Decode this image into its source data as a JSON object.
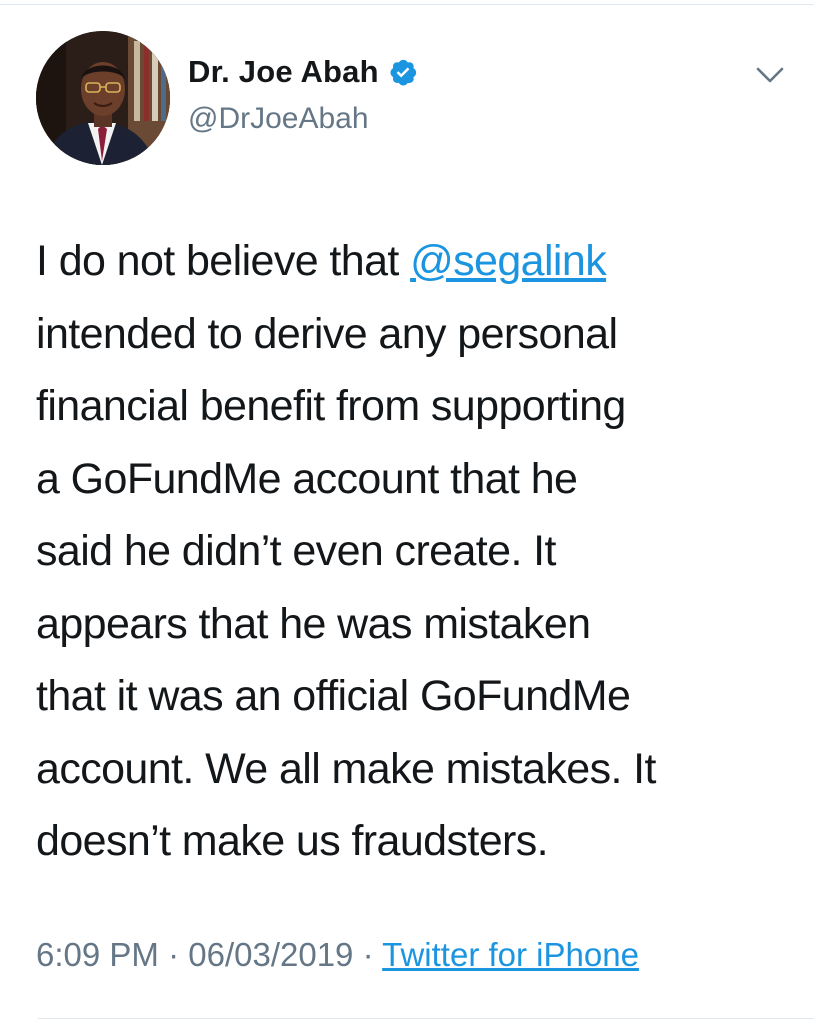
{
  "author": {
    "display_name": "Dr. Joe Abah",
    "handle": "@DrJoeAbah",
    "verified_icon": "verified-badge-icon",
    "avatar_icon": "profile-photo"
  },
  "menu": {
    "icon": "chevron-down-icon"
  },
  "tweet": {
    "lines": [
      {
        "before": "I do not believe that ",
        "mention": "@segalink",
        "after": ""
      },
      {
        "text": "intended to derive any personal"
      },
      {
        "text": "financial benefit from supporting"
      },
      {
        "text": "a GoFundMe account that he"
      },
      {
        "text": "said he didn’t even create. It"
      },
      {
        "text": "appears that he was mistaken"
      },
      {
        "text": "that it was an official GoFundMe"
      },
      {
        "text": "account. We all make mistakes. It"
      },
      {
        "text": "doesn’t make us fraudsters."
      }
    ]
  },
  "meta": {
    "time": "6:09 PM",
    "separator": " · ",
    "date": "06/03/2019",
    "source": "Twitter for iPhone"
  },
  "colors": {
    "link": "#1b95e0",
    "secondary": "#657786",
    "text": "#14171a"
  }
}
